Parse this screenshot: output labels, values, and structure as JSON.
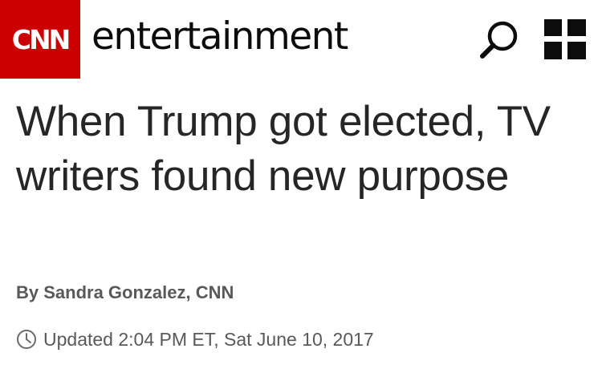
{
  "header": {
    "logo_text": "CNN",
    "section_name": "entertainment",
    "brand_color": "#cc0000",
    "search_icon": "search-icon",
    "menu_icon": "grid-menu-icon"
  },
  "article": {
    "headline": "When Trump got elected, TV writers found new purpose",
    "byline": "By Sandra Gonzalez, CNN",
    "timestamp_icon": "clock-icon",
    "timestamp": "Updated 2:04 PM ET, Sat June 10, 2017"
  }
}
